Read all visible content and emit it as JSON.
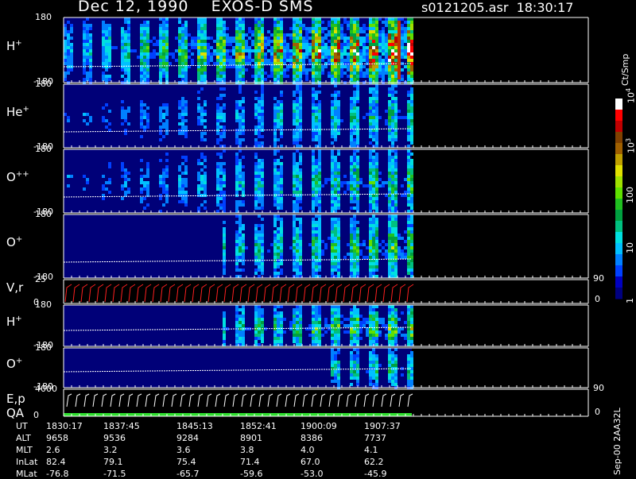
{
  "header": {
    "title": "Dec 12, 1990    EXOS-D SMS",
    "file": "s0121205.asr  18:30:17"
  },
  "chart_data": {
    "type": "heatmap",
    "panels": [
      {
        "label": "H",
        "sup": "+",
        "ymax": "180",
        "ymin": "-180",
        "kind": "spectro",
        "activity_start": 0.0,
        "intensity": 0.85
      },
      {
        "label": "He",
        "sup": "+",
        "ymax": "180",
        "ymin": "-180",
        "kind": "spectro",
        "activity_start": 0.1,
        "intensity": 0.35
      },
      {
        "label": "O",
        "sup": "++",
        "ymax": "180",
        "ymin": "-180",
        "kind": "spectro",
        "activity_start": 0.1,
        "intensity": 0.4
      },
      {
        "label": "O",
        "sup": "+",
        "ymax": "180",
        "ymin": "-180",
        "kind": "spectro",
        "activity_start": 0.45,
        "intensity": 0.45
      },
      {
        "label": "V,r",
        "sup": "",
        "ymax": "25",
        "ymin": "0",
        "kind": "line",
        "right_top": "90",
        "right_bottom": "0"
      },
      {
        "label": "H",
        "sup": "+",
        "ymax": "180",
        "ymin": "-180",
        "kind": "spectro",
        "activity_start": 0.45,
        "intensity": 0.5
      },
      {
        "label": "O",
        "sup": "+",
        "ymax": "180",
        "ymin": "-180",
        "kind": "spectro",
        "activity_start": 0.75,
        "intensity": 0.35
      },
      {
        "label": "E,p",
        "sup": "",
        "label2": "QA",
        "ymax": "4000",
        "ymin": "0",
        "kind": "energy",
        "right_top": "90",
        "right_bottom": "0"
      }
    ],
    "colorbar": {
      "unit": "Ct/Smp",
      "ticks": [
        {
          "label": "10",
          "sup": "4",
          "pos": 0.0
        },
        {
          "label": "10",
          "sup": "3",
          "pos": 0.25
        },
        {
          "label": "100",
          "sup": "",
          "pos": 0.5
        },
        {
          "label": "10",
          "sup": "",
          "pos": 0.75
        },
        {
          "label": "1",
          "sup": "",
          "pos": 1.0
        }
      ],
      "colors": [
        "#000080",
        "#0000c0",
        "#0040ff",
        "#0080ff",
        "#00c0ff",
        "#00e0e0",
        "#00c080",
        "#00a040",
        "#20c020",
        "#60e000",
        "#a0e000",
        "#e0e000",
        "#c0a000",
        "#a06000",
        "#804000",
        "#c00000",
        "#ff0000",
        "#ffffff"
      ]
    },
    "ephemeris": {
      "rows": [
        {
          "name": "UT",
          "values": [
            "1830:17",
            "1837:45",
            "1845:13",
            "1852:41",
            "1900:09",
            "1907:37"
          ]
        },
        {
          "name": "ALT",
          "values": [
            "9658",
            "9536",
            "9284",
            "8901",
            "8386",
            "7737"
          ]
        },
        {
          "name": "MLT",
          "values": [
            "2.6",
            "3.2",
            "3.6",
            "3.8",
            "4.0",
            "4.1"
          ]
        },
        {
          "name": "InLat",
          "values": [
            "82.4",
            "79.1",
            "75.4",
            "71.4",
            "67.0",
            "62.2"
          ]
        },
        {
          "name": "MLat",
          "values": [
            "-76.8",
            "-71.5",
            "-65.7",
            "-59.6",
            "-53.0",
            "-45.9"
          ]
        }
      ]
    }
  },
  "footer": {
    "text": "Sep-00  2AA32L"
  }
}
